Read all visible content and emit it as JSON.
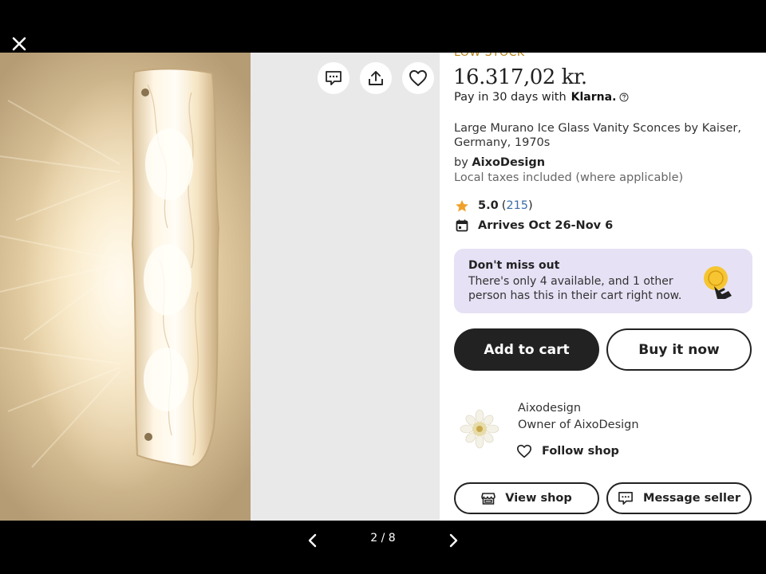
{
  "viewer": {
    "close_icon": "close-icon",
    "counter": "2 / 8",
    "prev_icon": "chevron-left-icon",
    "next_icon": "chevron-right-icon"
  },
  "image_actions": [
    {
      "name": "message-icon"
    },
    {
      "name": "share-icon"
    },
    {
      "name": "heart-icon"
    }
  ],
  "product": {
    "stock_label": "LOW STOCK",
    "price": "16.317,02 kr.",
    "pay_later": "Pay in 30 days with",
    "pay_brand": "Klarna.",
    "title": "Large Murano Ice Glass Vanity Sconces by Kaiser, Germany, 1970s",
    "by_prefix": "by",
    "shop": "AixoDesign",
    "taxes": "Local taxes included (where applicable)",
    "rating": "5.0",
    "review_count": "215",
    "arrival": "Arrives Oct 26-Nov 6"
  },
  "alert": {
    "title": "Don't miss out",
    "body": "There's only 4 available, and 1 other person has this in their cart right now."
  },
  "actions": {
    "add_to_cart": "Add to cart",
    "buy_now": "Buy it now"
  },
  "owner": {
    "name": "Aixodesign",
    "role": "Owner of AixoDesign",
    "follow": "Follow shop",
    "view_shop": "View shop",
    "message_seller": "Message seller"
  },
  "colors": {
    "accent_dark": "#222222",
    "stock_gold": "#b8861a",
    "alert_bg": "#e6e1f5",
    "link_blue": "#3d6ea8",
    "star": "#f1a129"
  }
}
